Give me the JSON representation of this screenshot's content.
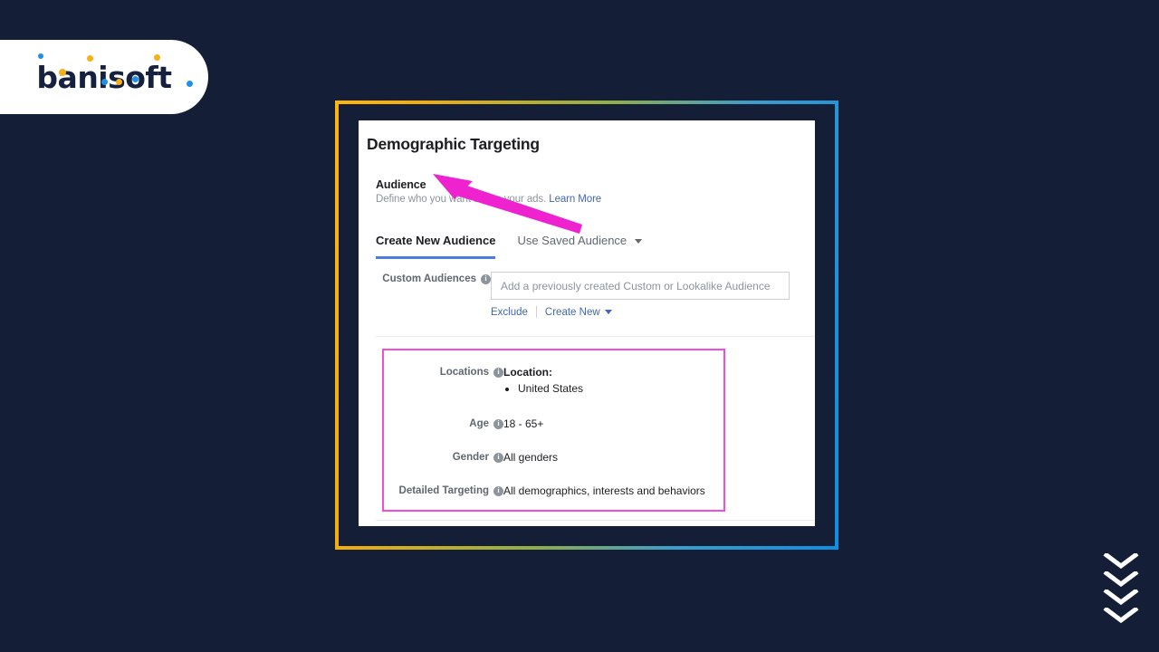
{
  "brand": {
    "name": "banisoft",
    "colors": {
      "navy": "#16213f",
      "yellow": "#f5b117",
      "blue": "#1e90e8",
      "pill_bg": "#ffffff"
    }
  },
  "page": {
    "background": "#141e37",
    "frame_gradient_from": "#ffb606",
    "frame_gradient_to": "#0d8fe0"
  },
  "card": {
    "title": "Demographic Targeting",
    "audience": {
      "heading": "Audience",
      "description": "Define who you want to see your ads.",
      "learn_more": "Learn More"
    },
    "tabs": [
      {
        "label": "Create New Audience",
        "active": true,
        "has_caret": false
      },
      {
        "label": "Use Saved Audience",
        "active": false,
        "has_caret": true
      }
    ],
    "custom_audiences": {
      "label": "Custom Audiences",
      "placeholder": "Add a previously created Custom or Lookalike Audience",
      "value": "",
      "exclude_link": "Exclude",
      "create_new_link": "Create New"
    },
    "targeting": {
      "highlight_color": "#ef4ddb",
      "rows": [
        {
          "label": "Locations",
          "value_title": "Location:",
          "value_items": [
            "United States"
          ]
        },
        {
          "label": "Age",
          "value": "18 - 65+"
        },
        {
          "label": "Gender",
          "value": "All genders"
        },
        {
          "label": "Detailed Targeting",
          "value": "All demographics, interests and behaviors"
        }
      ]
    }
  },
  "annotations": {
    "arrow_color": "#ef22cf",
    "arrow_target": "Audience"
  },
  "scroll_hint": {
    "icon": "chevron-down-icon",
    "count": 4,
    "color": "#ffffff"
  }
}
